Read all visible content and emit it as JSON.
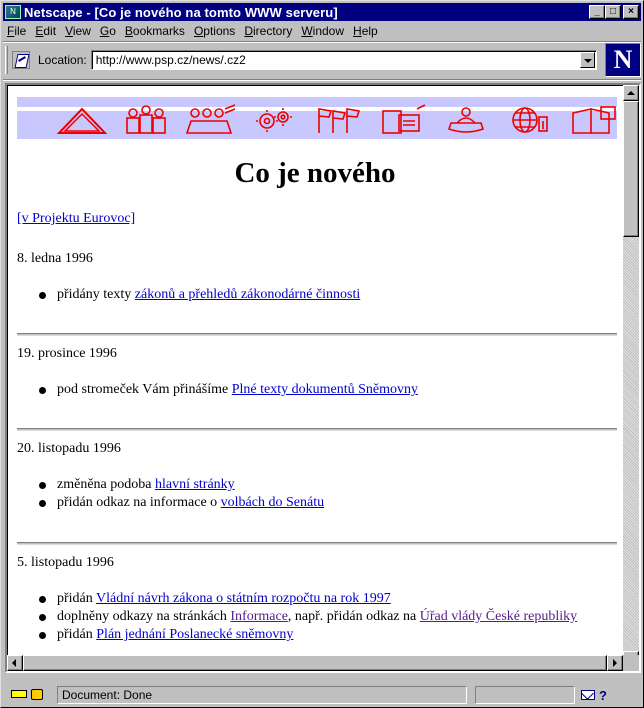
{
  "window": {
    "title": "Netscape - [Co je nového na tomto WWW serveru]",
    "app_icon": "netscape-app-icon",
    "controls": [
      "minimize",
      "maximize",
      "close"
    ]
  },
  "menu": [
    {
      "label": "File",
      "u": "F",
      "rest": "ile"
    },
    {
      "label": "Edit",
      "u": "E",
      "rest": "dit"
    },
    {
      "label": "View",
      "u": "V",
      "rest": "iew"
    },
    {
      "label": "Go",
      "u": "G",
      "rest": "o"
    },
    {
      "label": "Bookmarks",
      "u": "B",
      "rest": "ookmarks"
    },
    {
      "label": "Options",
      "u": "O",
      "rest": "ptions"
    },
    {
      "label": "Directory",
      "u": "D",
      "rest": "irectory"
    },
    {
      "label": "Window",
      "u": "W",
      "rest": "indow"
    },
    {
      "label": "Help",
      "u": "H",
      "rest": "elp"
    }
  ],
  "location": {
    "label": "Location:",
    "url": "http://www.psp.cz/news/.cz2"
  },
  "throbber": {
    "letter": "N"
  },
  "page": {
    "banner_icons": [
      "home-roof-icon",
      "people-group-icon",
      "assembly-icon",
      "gears-icon",
      "flags-icon",
      "documents-icon",
      "telephone-icon",
      "globe-info-icon",
      "book-icon"
    ],
    "title": "Co je nového",
    "eurovoc_link": "[v Projektu Eurovoc]",
    "sections": [
      {
        "date": "8. ledna 1996",
        "items": [
          {
            "prefix": "přidány texty ",
            "link": "zákonů a přehledů zákonodárné činnosti",
            "suffix": "",
            "link2": "",
            "suffix2": ""
          }
        ]
      },
      {
        "date": "19. prosince 1996",
        "items": [
          {
            "prefix": "pod stromeček Vám přinášíme ",
            "link": "Plné texty dokumentů Sněmovny",
            "suffix": "",
            "link2": "",
            "suffix2": ""
          }
        ]
      },
      {
        "date": "20. listopadu 1996",
        "items": [
          {
            "prefix": "změněna podoba ",
            "link": "hlavní stránky",
            "suffix": "",
            "link2": "",
            "suffix2": ""
          },
          {
            "prefix": "přidán odkaz na informace o ",
            "link": "volbách do Senátu",
            "suffix": "",
            "link2": "",
            "suffix2": ""
          }
        ]
      },
      {
        "date": "5. listopadu 1996",
        "items": [
          {
            "prefix": "přidán ",
            "link": "Vládní návrh zákona o státním rozpočtu na rok 1997",
            "suffix": "",
            "link2": "",
            "suffix2": ""
          },
          {
            "prefix": "doplněny odkazy na stránkách ",
            "link": "Informace",
            "suffix": ", např. přidán odkaz na ",
            "link2": "Úřad vlády České republiky",
            "suffix2": ""
          },
          {
            "prefix": "přidán ",
            "link": "Plán jednání Poslanecké sněmovny",
            "suffix": "",
            "link2": "",
            "suffix2": ""
          }
        ]
      }
    ]
  },
  "status": {
    "text": "Document: Done"
  }
}
